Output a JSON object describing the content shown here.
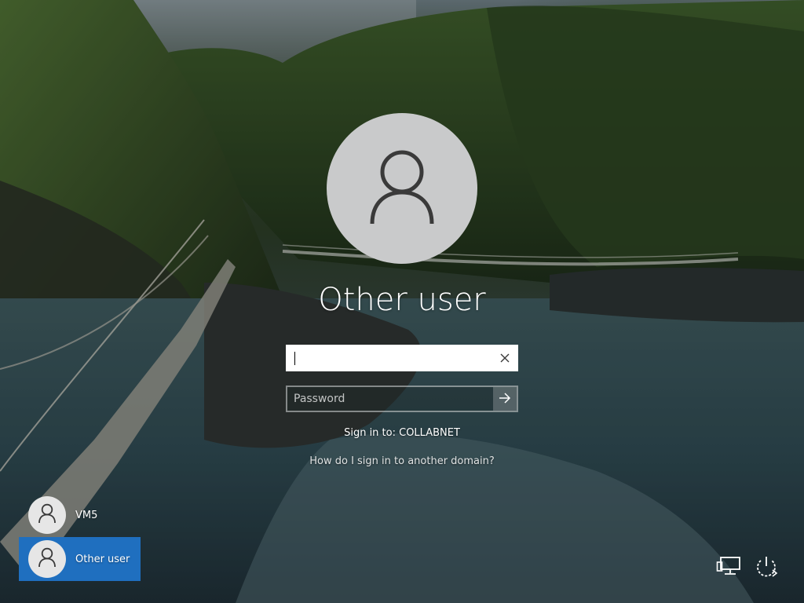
{
  "login": {
    "user_title": "Other user",
    "username_value": "",
    "password_placeholder": "Password",
    "sign_in_to": "Sign in to: COLLABNET",
    "domain_help_link": "How do I sign in to another domain?"
  },
  "user_list": [
    {
      "label": "VM5",
      "selected": false
    },
    {
      "label": "Other user",
      "selected": true
    }
  ],
  "icons": {
    "big_avatar": "user-icon",
    "clear": "close-icon",
    "submit": "arrow-right-icon",
    "network": "network-icon",
    "power": "power-icon"
  },
  "colors": {
    "selected_tile": "#1f6fbf",
    "avatar_circle": "#c9cacb",
    "text": "#ffffff"
  }
}
